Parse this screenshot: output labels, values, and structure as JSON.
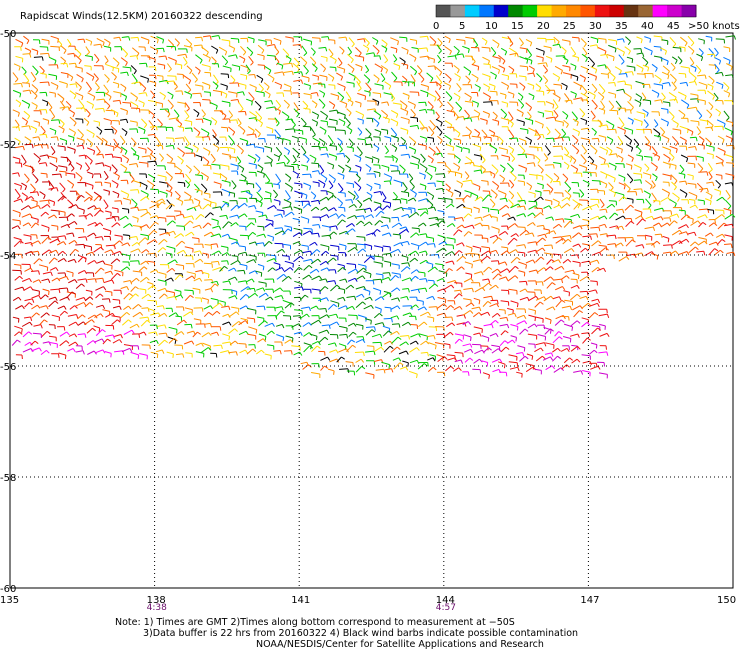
{
  "title": "Rapidscat Winds(12.5KM) 20160322 descending",
  "colorbar": {
    "labels": [
      "0",
      "5",
      "10",
      "15",
      "20",
      "25",
      "30",
      "35",
      "40",
      "45",
      ">50 knots"
    ],
    "colors": [
      "#555555",
      "#999999",
      "#00ccff",
      "#0077ff",
      "#0000cc",
      "#008800",
      "#00cc00",
      "#ffdd00",
      "#ffaa00",
      "#ff8800",
      "#ff5500",
      "#ee1111",
      "#cc0000",
      "#663311",
      "#996633",
      "#ff00ff",
      "#cc00cc",
      "#8800aa"
    ]
  },
  "axes": {
    "lat_labels": [
      "-50",
      "-52",
      "-54",
      "-56",
      "-58",
      "-60"
    ],
    "lon_labels": [
      "135",
      "138",
      "141",
      "144",
      "147",
      "150"
    ],
    "lat_range": [
      -60,
      -50
    ],
    "lon_range": [
      135,
      150
    ],
    "grid": "dotted"
  },
  "times": [
    {
      "lon": 138,
      "label": "4:38"
    },
    {
      "lon": 144,
      "label": "4:57"
    }
  ],
  "notes": {
    "line1": "Note: 1) Times are GMT 2)Times along bottom correspond to measurement at −50S",
    "line2": "3)Data buffer is 22 hrs from 20160322 4) Black wind barbs indicate possible contamination",
    "line3": "NOAA/NESDIS/Center for Satellite Applications and Research"
  }
}
